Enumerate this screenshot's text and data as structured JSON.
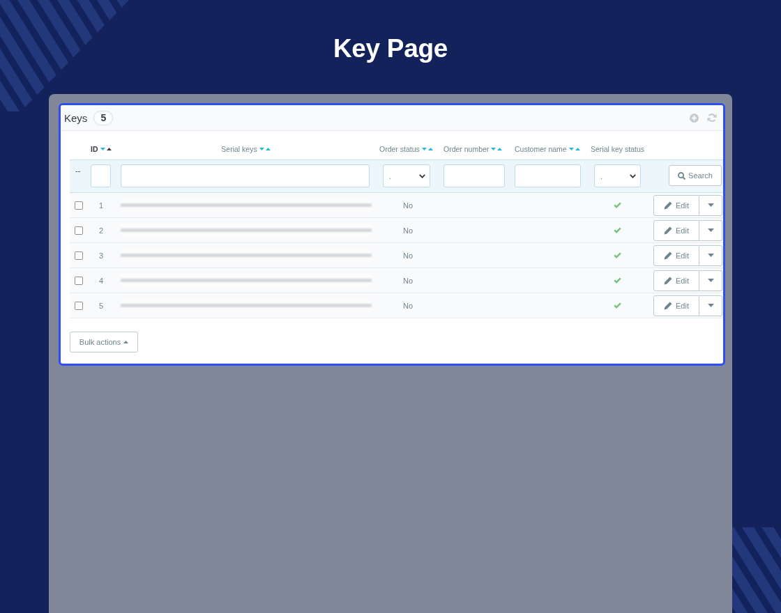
{
  "page": {
    "title": "Key Page"
  },
  "card": {
    "title": "Keys",
    "count": "5"
  },
  "table": {
    "columns": [
      {
        "label": "ID",
        "sortable": true,
        "sorted": true
      },
      {
        "label": "Serial keys",
        "sortable": true,
        "sorted": false
      },
      {
        "label": "Order status",
        "sortable": true,
        "sorted": false
      },
      {
        "label": "Order number",
        "sortable": true,
        "sorted": false
      },
      {
        "label": "Customer name",
        "sortable": true,
        "sorted": false
      },
      {
        "label": "Serial key status",
        "sortable": false,
        "sorted": false
      }
    ],
    "filters": {
      "marker": "--",
      "fields": [
        {
          "kind": "text"
        },
        {
          "kind": "text"
        },
        {
          "kind": "select",
          "value": "."
        },
        {
          "kind": "text"
        },
        {
          "kind": "text"
        },
        {
          "kind": "select",
          "value": "."
        }
      ],
      "search_button": "Search"
    },
    "rows": [
      {
        "id": "1",
        "checked": false,
        "order_status": "No",
        "key_active": true,
        "edit_label": "Edit"
      },
      {
        "id": "2",
        "checked": false,
        "order_status": "No",
        "key_active": true,
        "edit_label": "Edit"
      },
      {
        "id": "3",
        "checked": false,
        "order_status": "No",
        "key_active": true,
        "edit_label": "Edit"
      },
      {
        "id": "4",
        "checked": false,
        "order_status": "No",
        "key_active": true,
        "edit_label": "Edit"
      },
      {
        "id": "5",
        "checked": false,
        "order_status": "No",
        "key_active": true,
        "edit_label": "Edit"
      }
    ]
  },
  "bulk_actions": {
    "label": "Bulk actions"
  }
}
